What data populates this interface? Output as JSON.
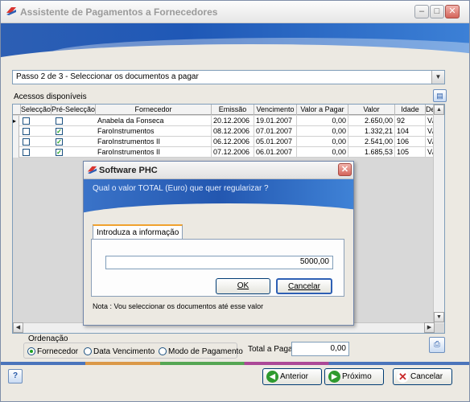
{
  "window": {
    "title": "Assistente de Pagamentos a Fornecedores"
  },
  "step": {
    "selected": "Passo 2 de 3 - Seleccionar os documentos a pagar"
  },
  "grid": {
    "section_label": "Acessos disponíveis",
    "columns": [
      "Selecção",
      "Pré-Selecção",
      "Fornecedor",
      "Emissão",
      "Vencimento",
      "Valor a Pagar",
      "Valor",
      "Idade",
      "De"
    ],
    "rows": [
      {
        "selecao": false,
        "pre_selecao": false,
        "fornecedor": "Anabela da Fonseca",
        "emissao": "20.12.2006",
        "vencimento": "19.01.2007",
        "valor_a_pagar": "0,00",
        "valor": "2.650,00",
        "idade": "92",
        "de": "V/"
      },
      {
        "selecao": false,
        "pre_selecao": true,
        "fornecedor": "FaroInstrumentos",
        "emissao": "08.12.2006",
        "vencimento": "07.01.2007",
        "valor_a_pagar": "0,00",
        "valor": "1.332,21",
        "idade": "104",
        "de": "V/"
      },
      {
        "selecao": false,
        "pre_selecao": true,
        "fornecedor": "FaroInstrumentos II",
        "emissao": "06.12.2006",
        "vencimento": "05.01.2007",
        "valor_a_pagar": "0,00",
        "valor": "2.541,00",
        "idade": "106",
        "de": "V/"
      },
      {
        "selecao": false,
        "pre_selecao": true,
        "fornecedor": "FaroInstrumentos II",
        "emissao": "07.12.2006",
        "vencimento": "06.01.2007",
        "valor_a_pagar": "0,00",
        "valor": "1.685,53",
        "idade": "105",
        "de": "V/"
      }
    ]
  },
  "ordering": {
    "label": "Ordenação",
    "options": [
      "Fornecedor",
      "Data Vencimento",
      "Modo de Pagamento"
    ],
    "selected": "Fornecedor"
  },
  "total": {
    "label": "Total a Pagar",
    "value": "0,00"
  },
  "buttons": {
    "help": "?",
    "previous": "Anterior",
    "next": "Próximo",
    "cancel": "Cancelar"
  },
  "dialog": {
    "title": "Software PHC",
    "question": "Qual o valor TOTAL (Euro) que quer regularizar ?",
    "tab": "Introduza a informação",
    "input_value": "5000,00",
    "ok": "OK",
    "cancel": "Cancelar",
    "note": "Nota : Vou seleccionar os documentos até esse valor"
  },
  "colors": {
    "banner_blue": "#2d5fb4",
    "check_green": "#21a121",
    "next_green": "#2e9a2e",
    "cancel_red": "#c92a2a"
  }
}
